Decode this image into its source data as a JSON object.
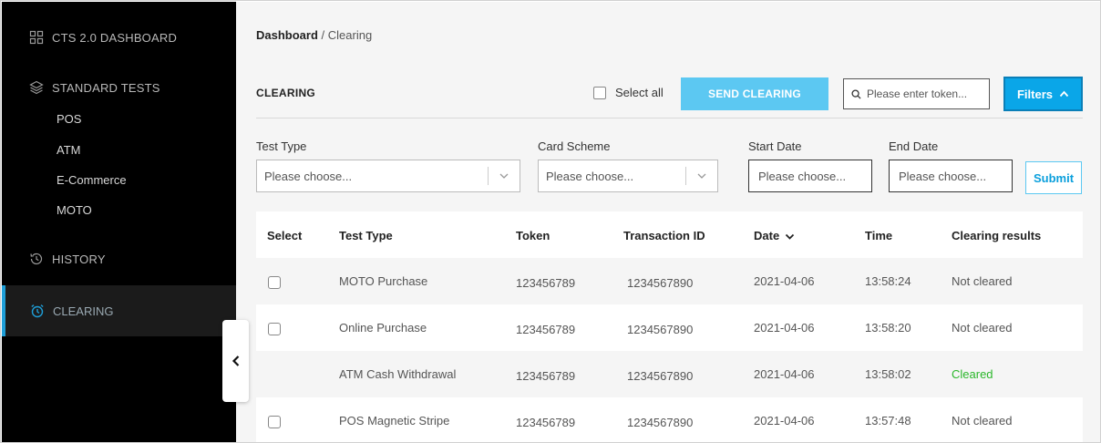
{
  "sidebar": {
    "dashboard": "CTS 2.0 DASHBOARD",
    "standard_tests": "STANDARD TESTS",
    "sub_items": [
      "POS",
      "ATM",
      "E-Commerce",
      "MOTO"
    ],
    "history": "HISTORY",
    "clearing": "CLEARING"
  },
  "breadcrumb": {
    "root": "Dashboard",
    "separator": "/",
    "current": "Clearing"
  },
  "toolbar": {
    "title": "CLEARING",
    "select_all": "Select all",
    "send_clearing": "SEND CLEARING",
    "search_placeholder": "Please enter token...",
    "filters": "Filters"
  },
  "filters": {
    "test_type_label": "Test Type",
    "test_type_placeholder": "Please choose...",
    "card_scheme_label": "Card Scheme",
    "card_scheme_placeholder": "Please choose...",
    "start_date_label": "Start Date",
    "start_date_placeholder": "Please choose...",
    "end_date_label": "End Date",
    "end_date_placeholder": "Please choose...",
    "submit": "Submit"
  },
  "table": {
    "columns": [
      "Select",
      "Test Type",
      "Token",
      "Transaction ID",
      "Date",
      "Time",
      "Clearing results"
    ],
    "rows": [
      {
        "selectable": true,
        "test_type": "MOTO Purchase",
        "token": "123456789",
        "transaction_id": "1234567890",
        "date": "2021-04-06",
        "time": "13:58:24",
        "result": "Not cleared"
      },
      {
        "selectable": true,
        "test_type": "Online Purchase",
        "token": "123456789",
        "transaction_id": "1234567890",
        "date": "2021-04-06",
        "time": "13:58:20",
        "result": "Not cleared"
      },
      {
        "selectable": false,
        "test_type": "ATM Cash Withdrawal",
        "token": "123456789",
        "transaction_id": "1234567890",
        "date": "2021-04-06",
        "time": "13:58:02",
        "result": "Cleared"
      },
      {
        "selectable": true,
        "test_type": "POS Magnetic Stripe",
        "token": "123456789",
        "transaction_id": "1234567890",
        "date": "2021-04-06",
        "time": "13:57:48",
        "result": "Not cleared"
      }
    ]
  },
  "colors": {
    "accent": "#0aa6e8",
    "send_button": "#5cc8f2",
    "cleared": "#2ab72a",
    "sidebar_bg": "#000000"
  },
  "icons": {
    "dashboard": "grid-icon",
    "standard_tests": "layers-icon",
    "history": "history-icon",
    "clearing": "alarm-clock-icon",
    "search": "search-icon",
    "filters": "chevron-up-icon",
    "dropdown": "chevron-down-icon",
    "date_sort": "chevron-down-icon",
    "collapse": "chevron-left-icon"
  }
}
